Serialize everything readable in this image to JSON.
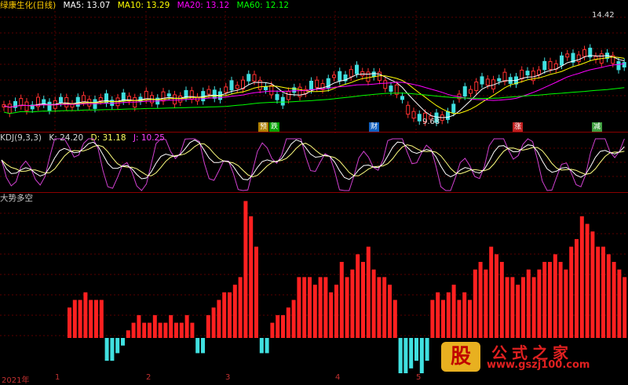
{
  "main": {
    "title": "绿康生化(日线)",
    "ma": [
      {
        "label": "MA5: 13.07",
        "color": "#ffffff"
      },
      {
        "label": "MA10: 13.29",
        "color": "#ffff00"
      },
      {
        "label": "MA20: 13.12",
        "color": "#ff00ff"
      },
      {
        "label": "MA60: 12.12",
        "color": "#00ff00"
      }
    ],
    "high_label": "14.42",
    "low_label": "9.68",
    "events": [
      "预",
      "跌",
      "财",
      "涨",
      "减"
    ]
  },
  "kdj": {
    "title": "KDJ(9,3,3)",
    "k": "K: 24.20",
    "d": "D: 31.18",
    "j": "J: 10.25"
  },
  "trend": {
    "title": "大势多空"
  },
  "xaxis": {
    "labels": [
      "2021年",
      "1",
      "2",
      "3",
      "4",
      "5"
    ]
  },
  "logo": {
    "mark": "股",
    "title": "公式之家",
    "url": "www.gszj100.com"
  },
  "colors": {
    "up": "#ff2020",
    "down": "#40e0e0",
    "grid": "#8b0000"
  },
  "chart_data": [
    {
      "type": "bar",
      "title": "大势多空",
      "values": [
        4,
        5,
        5,
        6,
        5,
        5,
        5,
        -3,
        -3,
        -2,
        -1,
        1,
        2,
        3,
        2,
        2,
        3,
        2,
        2,
        3,
        2,
        2,
        3,
        2,
        -2,
        -2,
        3,
        4,
        5,
        6,
        6,
        7,
        8,
        18,
        16,
        12,
        -2,
        -2,
        2,
        3,
        3,
        4,
        5,
        8,
        8,
        8,
        7,
        8,
        8,
        6,
        7,
        10,
        8,
        9,
        11,
        10,
        12,
        9,
        8,
        8,
        7,
        5,
        -5,
        -5,
        -4,
        -3,
        -5,
        -3,
        5,
        6,
        5,
        6,
        7,
        5,
        6,
        5,
        9,
        10,
        9,
        12,
        11,
        10,
        8,
        8,
        7,
        8,
        9,
        8,
        9,
        10,
        10,
        11,
        10,
        9,
        12,
        13,
        16,
        15,
        14,
        12,
        12,
        11,
        10,
        9,
        8,
        10
      ]
    },
    {
      "type": "line",
      "title": "KDJ(9,3,3)",
      "series": [
        {
          "name": "K",
          "values": [
            24.2
          ]
        },
        {
          "name": "D",
          "values": [
            31.18
          ]
        },
        {
          "name": "J",
          "values": [
            10.25
          ]
        }
      ]
    }
  ]
}
